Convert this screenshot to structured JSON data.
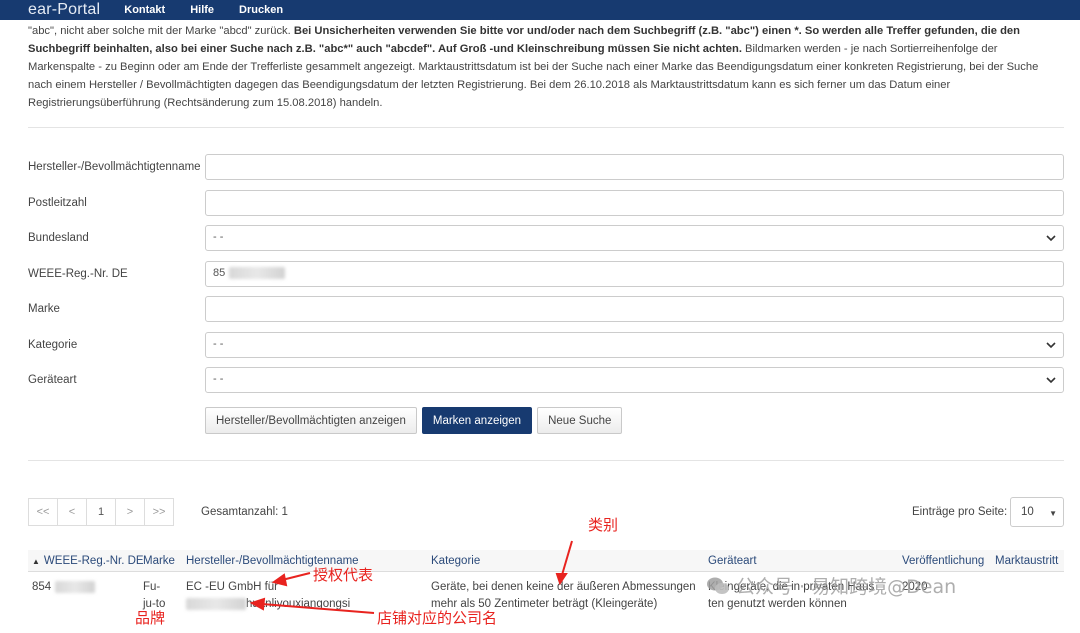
{
  "nav": {
    "brand": "ear-Portal",
    "links": [
      "Kontakt",
      "Hilfe",
      "Drucken"
    ]
  },
  "intro": {
    "p1_normal": "\"abc\", nicht aber solche mit der Marke \"abcd\" zurück. ",
    "p1_bold": "Bei Unsicherheiten verwenden Sie bitte vor und/oder nach dem Suchbegriff (z.B. \"abc\") einen *. So werden alle Treffer gefunden, die den Suchbegriff beinhalten, also bei einer Suche nach z.B. \"abc*\" auch \"abcdef\". Auf Groß -und Kleinschreibung müssen Sie nicht achten.",
    "p1_rest": " Bildmarken werden - je nach Sortierreihenfolge der Markenspalte - zu Beginn oder am Ende der Trefferliste gesammelt angezeigt. Marktaustrittsdatum ist bei der Suche nach einer Marke das Beendigungsdatum einer konkreten Registrierung, bei der Suche nach einem Hersteller / Bevollmächtigten dagegen das Beendigungsdatum der letzten Registrierung. Bei dem 26.10.2018 als Marktaustrittsdatum kann es sich ferner um das Datum einer Registrierungsüberführung (Rechtsänderung zum 15.08.2018) handeln."
  },
  "form": {
    "hersteller_label": "Hersteller-/Bevollmächtigtenname",
    "hersteller_value": "",
    "plz_label": "Postleitzahl",
    "plz_value": "",
    "bundesland_label": "Bundesland",
    "bundesland_value": "- -",
    "weee_label": "WEEE-Reg.-Nr. DE",
    "weee_value": "85",
    "marke_label": "Marke",
    "marke_value": "",
    "kategorie_label": "Kategorie",
    "kategorie_value": "- -",
    "geraeteart_label": "Geräteart",
    "geraeteart_value": "- -"
  },
  "buttons": {
    "hersteller": "Hersteller/Bevollmächtigten anzeigen",
    "marken": "Marken anzeigen",
    "neue": "Neue Suche"
  },
  "pager": {
    "first": "<<",
    "prev": "<",
    "current": "1",
    "next": ">",
    "last": ">>",
    "total": "Gesamtanzahl: 1",
    "per_page_label": "Einträge pro Seite:",
    "per_page_value": "10"
  },
  "table": {
    "headers": [
      "WEEE-Reg.-Nr. DE",
      "Marke",
      "Hersteller-/Bevollmächtigtenname",
      "Kategorie",
      "Geräteart",
      "Veröffentlichung",
      "Marktaustritt"
    ],
    "row": {
      "weee": "854",
      "marke_l1": "Fu-",
      "marke_l2": "ju-to",
      "hersteller_l1": "EC   -EU GmbH für",
      "hersteller_l2": "huanliyouxiangongsi",
      "kategorie_l1": "Geräte, bei denen keine der äußeren Abmessungen",
      "kategorie_l2": "mehr als 50 Zentimeter beträgt (Kleingeräte)",
      "geraeteart_l1": "Kleingeräte, die in privaten Haus",
      "geraeteart_l2": "ten genutzt werden können",
      "veroeffentlichung": "2020"
    }
  },
  "annotations": {
    "leibie": "类别",
    "shouquan": "授权代表",
    "pinpai": "品牌",
    "dianpu": "店铺对应的公司名"
  },
  "watermark": "公众号 · 易知跨境@Dean",
  "colors": {
    "nav_bg": "#173a70",
    "primary_button": "#173a70",
    "annotation_red": "#e8231f"
  }
}
